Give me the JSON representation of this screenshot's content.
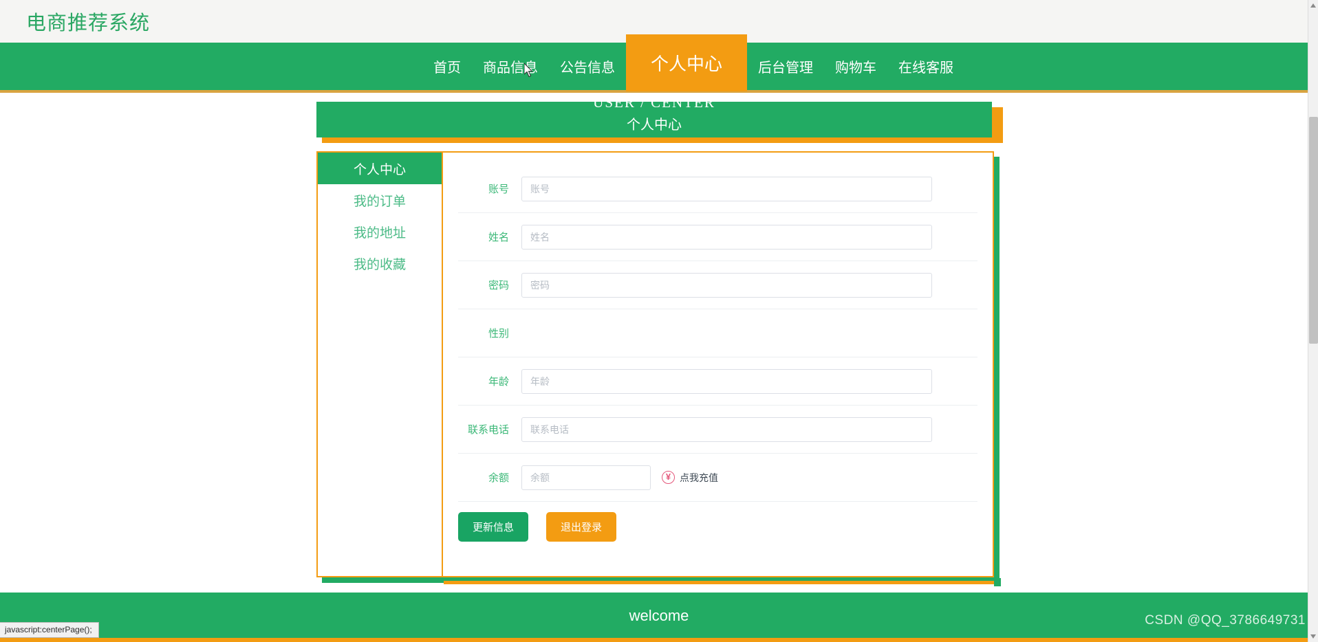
{
  "header": {
    "site_title": "电商推荐系统"
  },
  "nav": {
    "items": [
      {
        "label": "首页",
        "active": false
      },
      {
        "label": "商品信息",
        "active": false
      },
      {
        "label": "公告信息",
        "active": false
      },
      {
        "label": "个人中心",
        "active": true
      },
      {
        "label": "后台管理",
        "active": false
      },
      {
        "label": "购物车",
        "active": false
      },
      {
        "label": "在线客服",
        "active": false
      }
    ]
  },
  "banner": {
    "english": "USER / CENTER",
    "chinese": "个人中心"
  },
  "sidebar": {
    "items": [
      {
        "label": "个人中心",
        "active": true
      },
      {
        "label": "我的订单",
        "active": false
      },
      {
        "label": "我的地址",
        "active": false
      },
      {
        "label": "我的收藏",
        "active": false
      }
    ]
  },
  "form": {
    "fields": [
      {
        "label": "账号",
        "placeholder": "账号",
        "value": "",
        "type": "text"
      },
      {
        "label": "姓名",
        "placeholder": "姓名",
        "value": "",
        "type": "text"
      },
      {
        "label": "密码",
        "placeholder": "密码",
        "value": "",
        "type": "text"
      },
      {
        "label": "性别",
        "placeholder": "",
        "value": "",
        "type": "empty"
      },
      {
        "label": "年龄",
        "placeholder": "年龄",
        "value": "",
        "type": "text"
      },
      {
        "label": "联系电话",
        "placeholder": "联系电话",
        "value": "",
        "type": "text"
      },
      {
        "label": "余额",
        "placeholder": "余额",
        "value": "",
        "type": "balance"
      }
    ],
    "recharge_label": "点我充值",
    "recharge_icon": "¥",
    "submit_label": "更新信息",
    "logout_label": "退出登录"
  },
  "footer": {
    "text": "welcome",
    "watermark": "CSDN @QQ_3786649731"
  },
  "status_bar": {
    "text": "javascript:centerPage();"
  },
  "colors": {
    "brand_green": "#22ab63",
    "accent_orange": "#f39c12",
    "label_green": "#3cb878",
    "recharge_red": "#e4567a"
  }
}
